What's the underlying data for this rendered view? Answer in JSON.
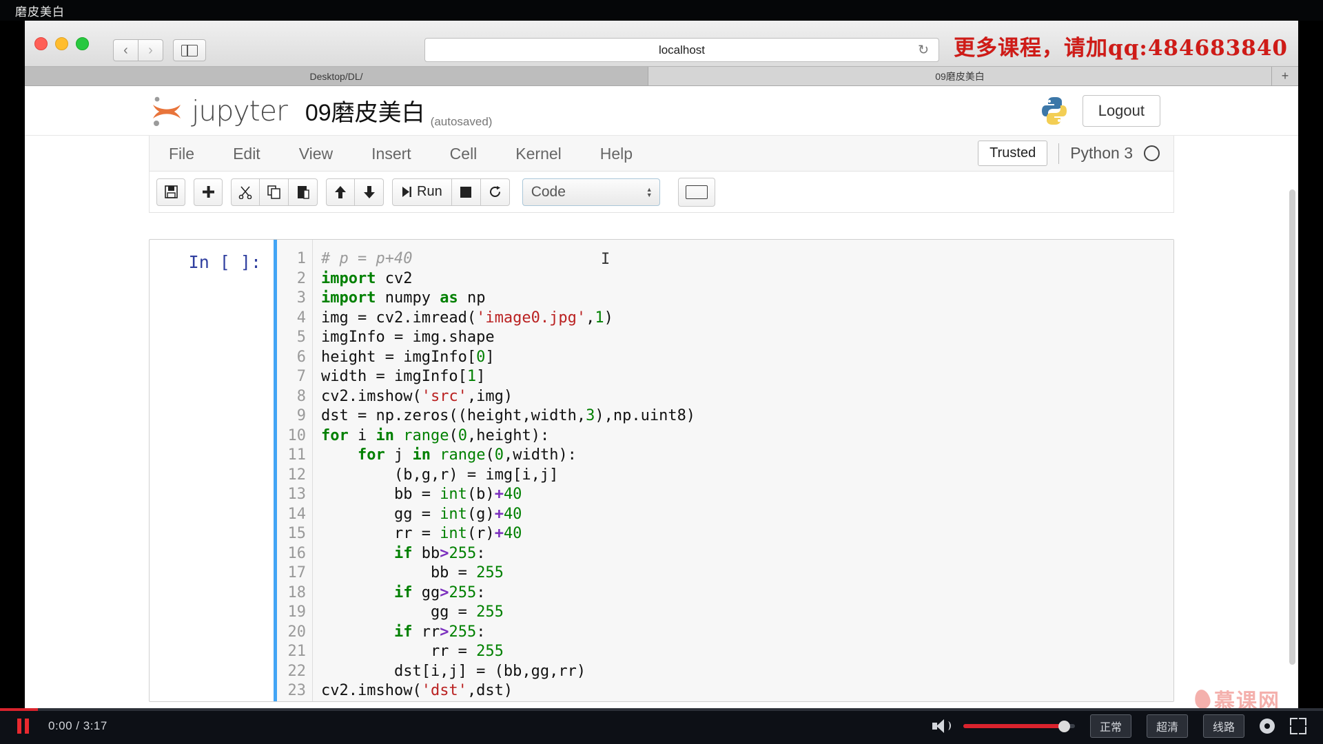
{
  "video": {
    "title": "磨皮美白",
    "current_time": "0:00",
    "duration": "3:17",
    "timecode": "0:00 / 3:17",
    "quality_buttons": [
      "正常",
      "超清",
      "线路"
    ],
    "watermark_logo": "慕课网",
    "accent_color": "#d9232d"
  },
  "browser": {
    "url": "localhost",
    "back_icon": "chevron-left-icon",
    "forward_icon": "chevron-right-icon",
    "sidebar_icon": "sidebar-toggle-icon",
    "reload_icon": "reload-icon",
    "tabs": [
      {
        "label": "Desktop/DL/",
        "active": true
      },
      {
        "label": "09磨皮美白",
        "active": false
      }
    ],
    "new_tab_icon": "plus-icon"
  },
  "overlay": {
    "promo_text": "更多课程，请加qq:484683840",
    "promo_color": "#cf1b17"
  },
  "jupyter": {
    "brand": "jupyter",
    "notebook_name": "09磨皮美白",
    "save_state": "(autosaved)",
    "logout_label": "Logout",
    "python_logo": "python-logo",
    "menu": [
      "File",
      "Edit",
      "View",
      "Insert",
      "Cell",
      "Kernel",
      "Help"
    ],
    "trusted_label": "Trusted",
    "kernel_name": "Python 3",
    "kernel_status": "idle",
    "toolbar": {
      "save_icon": "save-icon",
      "insert_icon": "plus-icon",
      "cut_icon": "scissors-icon",
      "copy_icon": "copy-icon",
      "paste_icon": "paste-icon",
      "up_icon": "arrow-up-icon",
      "down_icon": "arrow-down-icon",
      "run_label": "Run",
      "run_icon": "run-icon",
      "stop_icon": "stop-icon",
      "restart_icon": "restart-icon",
      "cell_type": "Code",
      "keyboard_icon": "keyboard-icon"
    }
  },
  "cell": {
    "prompt": "In [ ]:",
    "line_numbers": [
      1,
      2,
      3,
      4,
      5,
      6,
      7,
      8,
      9,
      10,
      11,
      12,
      13,
      14,
      15,
      16,
      17,
      18,
      19,
      20,
      21,
      22,
      23
    ],
    "code_lines": [
      "# p = p+40",
      "import cv2",
      "import numpy as np",
      "img = cv2.imread('image0.jpg',1)",
      "imgInfo = img.shape",
      "height = imgInfo[0]",
      "width = imgInfo[1]",
      "cv2.imshow('src',img)",
      "dst = np.zeros((height,width,3),np.uint8)",
      "for i in range(0,height):",
      "    for j in range(0,width):",
      "        (b,g,r) = img[i,j]",
      "        bb = int(b)+40",
      "        gg = int(g)+40",
      "        rr = int(r)+40",
      "        if bb>255:",
      "            bb = 255",
      "        if gg>255:",
      "            gg = 255",
      "        if rr>255:",
      "            rr = 255",
      "        dst[i,j] = (bb,gg,rr)",
      "cv2.imshow('dst',dst)"
    ]
  }
}
